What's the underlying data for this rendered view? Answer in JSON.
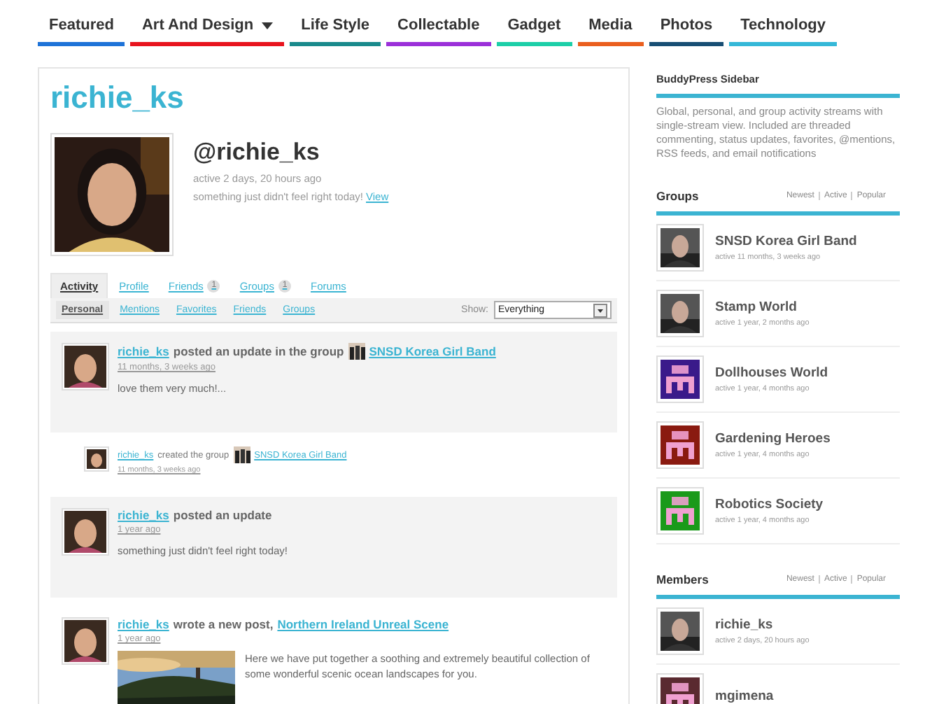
{
  "nav": [
    {
      "label": "Featured",
      "color": "#1e73d8",
      "dropdown": false
    },
    {
      "label": "Art And Design",
      "color": "#e8141e",
      "dropdown": true
    },
    {
      "label": "Life Style",
      "color": "#1a8a8c",
      "dropdown": false
    },
    {
      "label": "Collectable",
      "color": "#9b30d9",
      "dropdown": false
    },
    {
      "label": "Gadget",
      "color": "#1ccfa8",
      "dropdown": false
    },
    {
      "label": "Media",
      "color": "#ea5f1e",
      "dropdown": false
    },
    {
      "label": "Photos",
      "color": "#184e74",
      "dropdown": false
    },
    {
      "label": "Technology",
      "color": "#35b8d8",
      "dropdown": false
    }
  ],
  "profile": {
    "title": "richie_ks",
    "handle": "@richie_ks",
    "active": "active 2 days, 20 hours ago",
    "status": "something just didn't feel right today!",
    "status_link": "View"
  },
  "tabs": [
    {
      "label": "Activity",
      "selected": true
    },
    {
      "label": "Profile",
      "selected": false
    },
    {
      "label": "Friends",
      "count": "1",
      "selected": false
    },
    {
      "label": "Groups",
      "count": "1",
      "selected": false
    },
    {
      "label": "Forums",
      "selected": false
    }
  ],
  "subtabs": [
    {
      "label": "Personal",
      "selected": true
    },
    {
      "label": "Mentions",
      "selected": false
    },
    {
      "label": "Favorites",
      "selected": false
    },
    {
      "label": "Friends",
      "selected": false
    },
    {
      "label": "Groups",
      "selected": false
    }
  ],
  "filter": {
    "label": "Show:",
    "value": "Everything"
  },
  "activities": [
    {
      "kind": "update",
      "user": "richie_ks",
      "action": "posted an update in the group",
      "target": "SNSD Korea Girl Band",
      "time": "11 months, 3 weeks ago",
      "content": "love them very much!..."
    },
    {
      "kind": "mini",
      "user": "richie_ks",
      "action": "created the group",
      "target": "SNSD Korea Girl Band",
      "time": "11 months, 3 weeks ago"
    },
    {
      "kind": "update",
      "user": "richie_ks",
      "action": "posted an update",
      "time": "1 year ago",
      "content": "something just didn't feel right today!"
    },
    {
      "kind": "post",
      "user": "richie_ks",
      "action": "wrote a new post,",
      "target": "Northern Ireland Unreal Scene",
      "time": "1 year ago",
      "content": "Here we have put together a soothing and extremely beautiful collection of some wonderful scenic ocean landscapes for you."
    }
  ],
  "sidebar": {
    "title": "BuddyPress Sidebar",
    "description": "Global, personal, and group activity streams with single-stream view. Included are threaded commenting, status updates, favorites, @mentions, RSS feeds, and email notifications",
    "widgets": [
      {
        "title": "Groups",
        "filters": [
          "Newest",
          "Active",
          "Popular"
        ],
        "items": [
          {
            "name": "SNSD Korea Girl Band",
            "meta": "active 11 months, 3 weeks ago"
          },
          {
            "name": "Stamp World",
            "meta": "active 1 year, 2 months ago"
          },
          {
            "name": "Dollhouses World",
            "meta": "active 1 year, 4 months ago",
            "kind": "pixel",
            "color": "#3a1a8a"
          },
          {
            "name": "Gardening Heroes",
            "meta": "active 1 year, 4 months ago",
            "kind": "pixel",
            "color": "#8a1a10"
          },
          {
            "name": "Robotics Society",
            "meta": "active 1 year, 4 months ago",
            "kind": "pixel",
            "color": "#1a9a1a"
          }
        ]
      },
      {
        "title": "Members",
        "filters": [
          "Newest",
          "Active",
          "Popular"
        ],
        "items": [
          {
            "name": "richie_ks",
            "meta": "active 2 days, 20 hours ago"
          },
          {
            "name": "mgimena",
            "kind": "pixel",
            "color": "#5a2a30"
          }
        ]
      }
    ]
  }
}
